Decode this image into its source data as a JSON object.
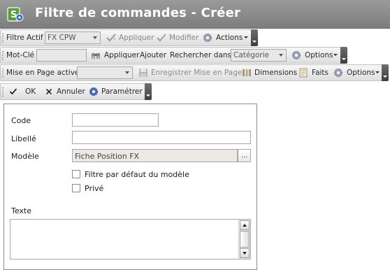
{
  "window": {
    "title": "Filtre de commandes - Créer"
  },
  "toolbar1": {
    "active_filter_label": "Filtre Actif",
    "active_filter_value": "FX CPW",
    "apply": "Appliquer",
    "modify": "Modifier",
    "actions": "Actions"
  },
  "toolbar2": {
    "keyword_label": "Mot-Clé",
    "keyword_value": "",
    "apply": "Appliquer",
    "add": "Ajouter",
    "search_in_label": "Rechercher dans",
    "search_in_value": "Catégorie",
    "options": "Options"
  },
  "toolbar3": {
    "active_layout_label": "Mise en Page active",
    "active_layout_value": "",
    "save_layout": "Enregistrer Mise en Page",
    "dimensions": "Dimensions",
    "facts": "Faits",
    "options": "Options"
  },
  "toolbar4": {
    "ok": "OK",
    "cancel": "Annuler",
    "settings": "Paramétrer"
  },
  "form": {
    "code_label": "Code",
    "code_value": "",
    "libelle_label": "Libellé",
    "libelle_value": "",
    "modele_label": "Modèle",
    "modele_value": "Fiche Position FX",
    "lookup_label": "...",
    "default_filter_label": "Filtre par défaut du modèle",
    "default_filter_checked": false,
    "private_label": "Privé",
    "private_checked": false,
    "text_label": "Texte",
    "text_value": ""
  },
  "colors": {
    "titlebar": "#8a8a8a",
    "toolbar_bg": "#e8e8e8",
    "toolbar_end": "#4a4a4a",
    "gear_blue": "#4b6fb5"
  }
}
